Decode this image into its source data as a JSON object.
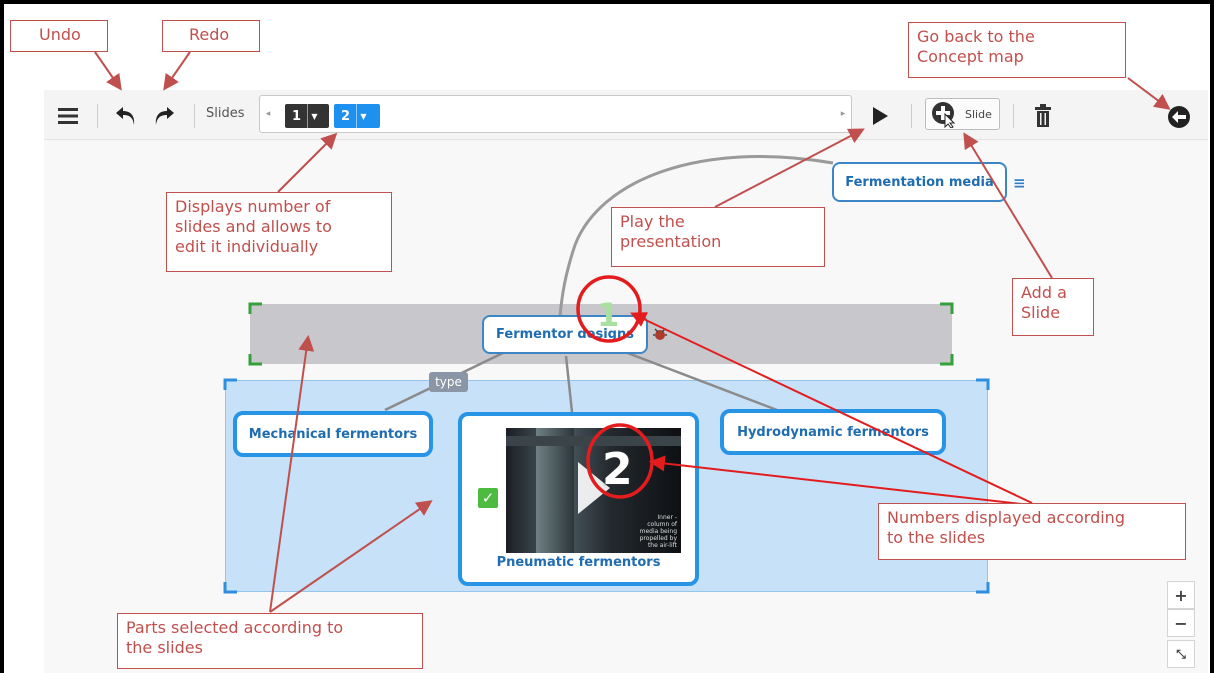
{
  "toolbar": {
    "slides_label": "Slides",
    "slide_chips": [
      {
        "number": "1",
        "color": "#333333"
      },
      {
        "number": "2",
        "color": "#1e90f0"
      }
    ],
    "add_slide_label": "Slide",
    "icons": {
      "menu": "hamburger-icon",
      "undo": "undo-icon",
      "redo": "redo-icon",
      "play": "play-icon",
      "add_slide": "add-slide-icon",
      "delete": "trash-icon",
      "back": "back-arrow-icon"
    }
  },
  "map": {
    "root": "Fermentation media",
    "center": "Fermentor designs",
    "relation_tag": "type",
    "children": {
      "left": "Mechanical fermentors",
      "middle": "Pneumatic fermentors",
      "right": "Hydrodynamic fermentors"
    },
    "slide_markers": [
      "1",
      "2"
    ],
    "video_caption": [
      "Inner -",
      "column of",
      "media being",
      "propelled by",
      "the air-lift"
    ]
  },
  "zoom": {
    "in": "+",
    "out": "−",
    "fit": "⤡"
  },
  "annotations": {
    "undo": "Undo",
    "redo": "Redo",
    "concept_map": [
      "Go back to the",
      "Concept map"
    ],
    "slides_info": [
      "Displays number of",
      "slides and allows to",
      "edit it individually"
    ],
    "play": [
      "Play the",
      "presentation"
    ],
    "add_slide": [
      "Add a",
      "Slide"
    ],
    "numbers": [
      "Numbers displayed according",
      "to the slides"
    ],
    "parts": [
      "Parts selected according to",
      "the slides"
    ]
  },
  "colors": {
    "annotation": "#c0504d",
    "highlight_circle": "#e31d1d",
    "node_border": "#2894e6",
    "node_text": "#1f6db0",
    "slide1_band": "#c7c7cc",
    "slide2_band": "#c6e1f8"
  }
}
